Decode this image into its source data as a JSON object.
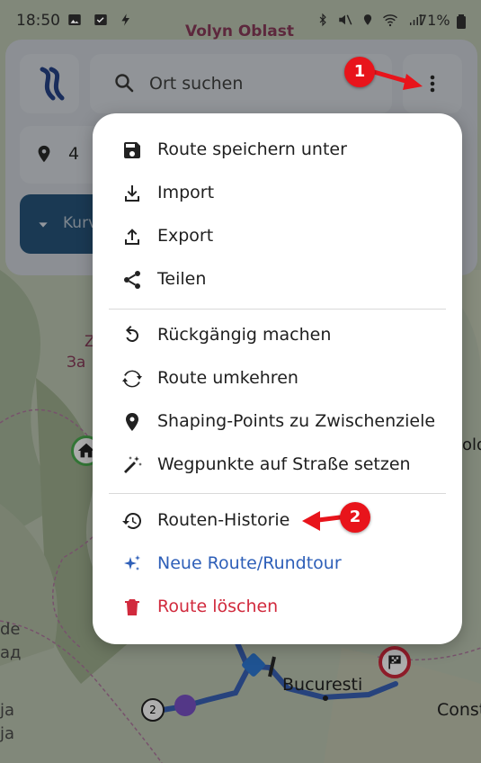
{
  "status_bar": {
    "time": "18:50",
    "left_icons": [
      "gallery-icon",
      "check-box-icon",
      "flash-icon"
    ],
    "right_icons": [
      "bluetooth-icon",
      "mute-icon",
      "location-icon",
      "wifi-icon",
      "signal-icon"
    ],
    "battery": "71%"
  },
  "map": {
    "labels": {
      "region_top": "Volyn Oblast",
      "city_bucharest": "Bucuresti",
      "city_const": "Const",
      "left_de": "de",
      "left_ad": "ад",
      "left_ja": "ja",
      "left_ja2": "ja",
      "left_z": "Z",
      "left_zak": "За",
      "right_old": "old"
    },
    "waypoint_marker_label": "2",
    "route_color": "#3a63b8"
  },
  "top_panel": {
    "search_placeholder": "Ort suchen",
    "waypoint_count": "4",
    "curve_button_label": "Kurv"
  },
  "menu": {
    "items": [
      {
        "label": "Route speichern unter",
        "icon": "save-icon"
      },
      {
        "label": "Import",
        "icon": "download-icon"
      },
      {
        "label": "Export",
        "icon": "upload-icon"
      },
      {
        "label": "Teilen",
        "icon": "share-icon"
      },
      {
        "label": "Rückgängig machen",
        "icon": "undo-icon"
      },
      {
        "label": "Route umkehren",
        "icon": "reverse-icon"
      },
      {
        "label": "Shaping-Points zu Zwischenziele",
        "icon": "location-pin-icon"
      },
      {
        "label": "Wegpunkte auf Straße setzen",
        "icon": "magic-wand-icon"
      },
      {
        "label": "Routen-Historie",
        "icon": "history-icon"
      },
      {
        "label": "Neue Route/Rundtour",
        "icon": "sparkle-icon"
      },
      {
        "label": "Route löschen",
        "icon": "trash-icon"
      }
    ]
  },
  "annotations": {
    "badge_1": "1",
    "badge_2": "2"
  },
  "colors": {
    "accent_blue": "#2e5fb8",
    "danger_red": "#d12a3d",
    "annotation_red": "#e8141b",
    "curve_button": "#1f4f79"
  }
}
